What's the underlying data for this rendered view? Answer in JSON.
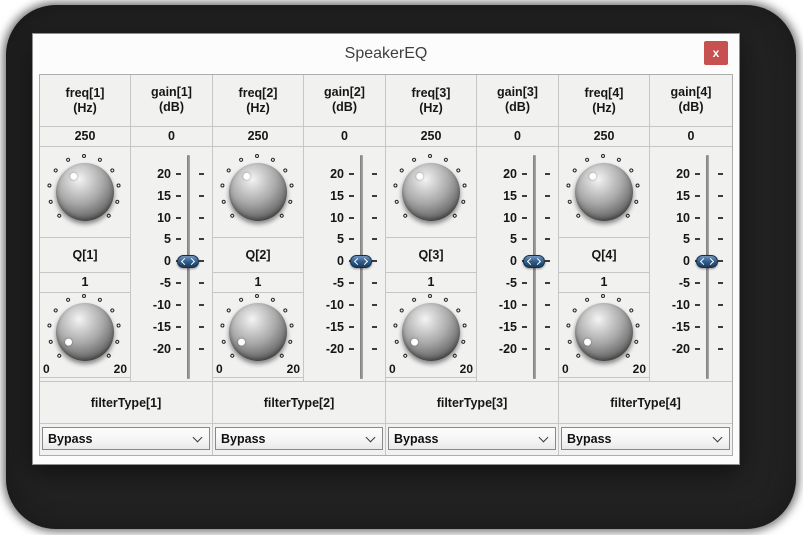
{
  "window": {
    "title": "SpeakerEQ"
  },
  "icons": {
    "close_glyph": "x",
    "close_icon": "close-x",
    "dropdown_icon": "chevron-down",
    "knob_indicator_icon": "white-dot",
    "slider_thumb_icon": "left-right-chevron-pill"
  },
  "colors": {
    "close_button": "#c75050",
    "backdrop": "#232323",
    "panel_bg": "#f1f1f0",
    "grid_border": "#c6c6c6",
    "slider_thumb": "#33608f",
    "text": "#161616"
  },
  "knob": {
    "tick_count": 11,
    "arc_start_deg": -135,
    "arc_end_deg": 135,
    "freq_indicator_deg": -36,
    "q_indicator_deg": -122,
    "q_scale_min_label": "0",
    "q_scale_max_label": "20"
  },
  "slider": {
    "tick_labels": [
      "20",
      "15",
      "10",
      "5",
      "0",
      "-5",
      "-10",
      "-15",
      "-20"
    ],
    "thumb_tick_index": 4,
    "thumb_value": "0"
  },
  "channels": [
    {
      "freq_label": "freq[1]",
      "freq_unit": "(Hz)",
      "freq_value": "250",
      "gain_label": "gain[1]",
      "gain_unit": "(dB)",
      "gain_value": "0",
      "q_label": "Q[1]",
      "q_value": "1",
      "filter_label": "filterType[1]",
      "filter_value": "Bypass"
    },
    {
      "freq_label": "freq[2]",
      "freq_unit": "(Hz)",
      "freq_value": "250",
      "gain_label": "gain[2]",
      "gain_unit": "(dB)",
      "gain_value": "0",
      "q_label": "Q[2]",
      "q_value": "1",
      "filter_label": "filterType[2]",
      "filter_value": "Bypass"
    },
    {
      "freq_label": "freq[3]",
      "freq_unit": "(Hz)",
      "freq_value": "250",
      "gain_label": "gain[3]",
      "gain_unit": "(dB)",
      "gain_value": "0",
      "q_label": "Q[3]",
      "q_value": "1",
      "filter_label": "filterType[3]",
      "filter_value": "Bypass"
    },
    {
      "freq_label": "freq[4]",
      "freq_unit": "(Hz)",
      "freq_value": "250",
      "gain_label": "gain[4]",
      "gain_unit": "(dB)",
      "gain_value": "0",
      "q_label": "Q[4]",
      "q_value": "1",
      "filter_label": "filterType[4]",
      "filter_value": "Bypass"
    }
  ]
}
